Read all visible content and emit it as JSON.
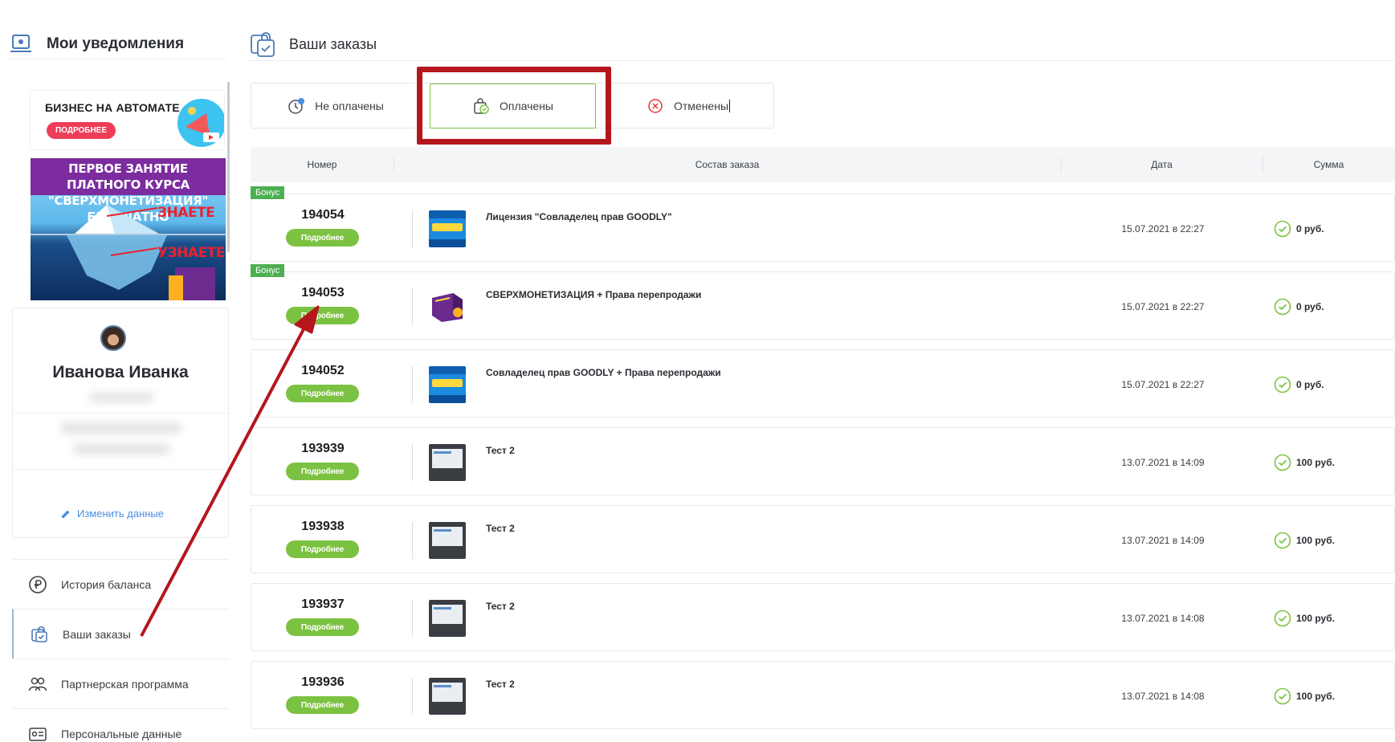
{
  "sidebar": {
    "notifications_title": "Мои уведомления",
    "banner_business": {
      "text": "БИЗНЕС НА АВТОМАТЕ",
      "button": "ПОДРОБНЕЕ"
    },
    "banner_course": {
      "line1": "ПЕРВОЕ ЗАНЯТИЕ ПЛАТНОГО КУРСА",
      "line2": "\"СВЕРХМОНЕТИЗАЦИЯ\" БЕСПЛАТНО",
      "know": "ЗНАЕТЕ",
      "learn": "УЗНАЕТЕ"
    },
    "profile": {
      "name": "Иванова Иванка",
      "edit_label": "Изменить данные"
    },
    "menu": [
      {
        "label": "История баланса",
        "icon": "ruble-icon"
      },
      {
        "label": "Ваши заказы",
        "icon": "orders-bag-icon",
        "active": true
      },
      {
        "label": "Партнерская программа",
        "icon": "partners-icon"
      },
      {
        "label": "Персональные данные",
        "icon": "id-card-icon"
      }
    ]
  },
  "main": {
    "title": "Ваши заказы",
    "tabs": [
      {
        "label": "Не оплачены",
        "icon": "clock-icon"
      },
      {
        "label": "Оплачены",
        "icon": "paid-bag-icon",
        "active": true
      },
      {
        "label": "Отменены",
        "icon": "cancel-icon"
      }
    ],
    "columns": {
      "number": "Номер",
      "contents": "Состав заказа",
      "date": "Дата",
      "sum": "Сумма"
    },
    "more_label": "Подробнее",
    "bonus_label": "Бонус",
    "orders": [
      {
        "number": "194054",
        "product": "Лицензия \"Совладелец прав GOODLY\"",
        "date": "15.07.2021 в 22:27",
        "sum": "0 руб.",
        "bonus": true,
        "thumb": "goodly"
      },
      {
        "number": "194053",
        "product": "СВЕРХМОНЕТИЗАЦИЯ + Права перепродажи",
        "date": "15.07.2021 в 22:27",
        "sum": "0 руб.",
        "bonus": true,
        "thumb": "box"
      },
      {
        "number": "194052",
        "product": "Совладелец прав GOODLY + Права перепродажи",
        "date": "15.07.2021 в 22:27",
        "sum": "0 руб.",
        "bonus": false,
        "thumb": "goodly"
      },
      {
        "number": "193939",
        "product": "Тест 2",
        "date": "13.07.2021 в 14:09",
        "sum": "100 руб.",
        "bonus": false,
        "thumb": "test"
      },
      {
        "number": "193938",
        "product": "Тест 2",
        "date": "13.07.2021 в 14:09",
        "sum": "100 руб.",
        "bonus": false,
        "thumb": "test"
      },
      {
        "number": "193937",
        "product": "Тест 2",
        "date": "13.07.2021 в 14:08",
        "sum": "100 руб.",
        "bonus": false,
        "thumb": "test"
      },
      {
        "number": "193936",
        "product": "Тест 2",
        "date": "13.07.2021 в 14:08",
        "sum": "100 руб.",
        "bonus": false,
        "thumb": "test"
      }
    ]
  },
  "colors": {
    "accent_green": "#7cc242",
    "bonus_green": "#4caf50",
    "annotation_red": "#b5161c",
    "link_blue": "#4a90e2"
  }
}
